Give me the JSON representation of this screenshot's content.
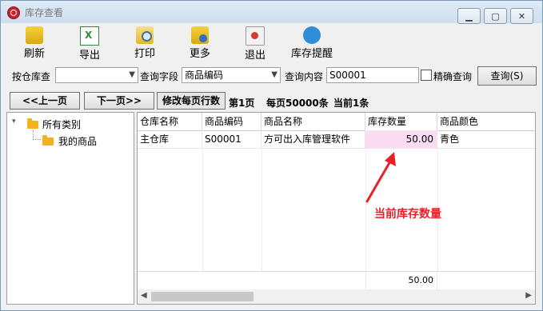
{
  "window": {
    "title": "库存查看"
  },
  "toolbar": {
    "buttons": [
      {
        "label": "刷新",
        "icon": "refresh-icon"
      },
      {
        "label": "导出",
        "icon": "excel-export-icon"
      },
      {
        "label": "打印",
        "icon": "print-icon"
      },
      {
        "label": "更多",
        "icon": "more-icon"
      },
      {
        "label": "退出",
        "icon": "exit-icon"
      },
      {
        "label": "库存提醒",
        "icon": "alert-bubble-icon"
      }
    ]
  },
  "search": {
    "warehouse_label": "按仓库查",
    "warehouse_value": "",
    "field_label": "查询字段",
    "field_value": "商品编码",
    "content_label": "查询内容",
    "content_value": "S00001",
    "exact_label": "精确查询",
    "query_button": "查询(S)"
  },
  "paging": {
    "prev": "<<上一页",
    "next": "下一页>>",
    "edit_rows": "修改每页行数",
    "page": "第1页",
    "per_page": "每页50000条",
    "current": "当前1条"
  },
  "tree": {
    "root": "所有类别",
    "child": "我的商品"
  },
  "table": {
    "columns": [
      "仓库名称",
      "商品编码",
      "商品名称",
      "库存数量",
      "商品颜色"
    ],
    "rows": [
      [
        "主仓库",
        "S00001",
        "方可出入库管理软件",
        "50.00",
        "青色"
      ]
    ],
    "total": "50.00"
  },
  "annotation": {
    "text": "当前库存数量",
    "color": "#e8202a"
  },
  "colors": {
    "highlight_cell": "#fbdcf2",
    "folder": "#f3b21c"
  }
}
